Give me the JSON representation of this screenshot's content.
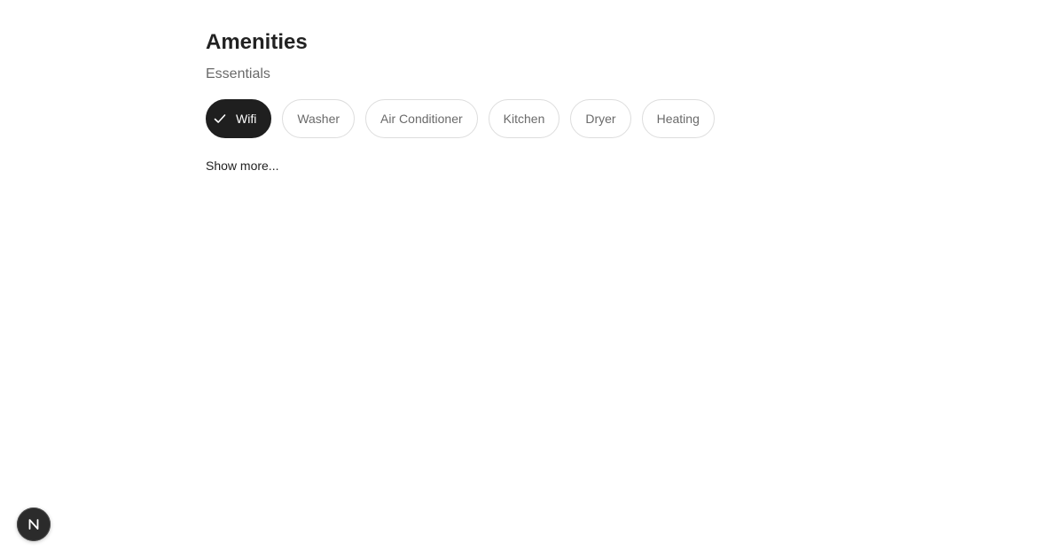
{
  "section": {
    "title": "Amenities",
    "subtitle": "Essentials"
  },
  "amenities": [
    {
      "label": "Wifi",
      "selected": true
    },
    {
      "label": "Washer",
      "selected": false
    },
    {
      "label": "Air Conditioner",
      "selected": false
    },
    {
      "label": "Kitchen",
      "selected": false
    },
    {
      "label": "Dryer",
      "selected": false
    },
    {
      "label": "Heating",
      "selected": false
    }
  ],
  "show_more_label": "Show more...",
  "dev_badge": {
    "icon": "next-logo-icon",
    "letter": "N"
  },
  "colors": {
    "selected_bg": "#1f1f1f",
    "chip_border": "#dddddd",
    "muted_text": "#6a6a6a",
    "heading_text": "#222222"
  }
}
